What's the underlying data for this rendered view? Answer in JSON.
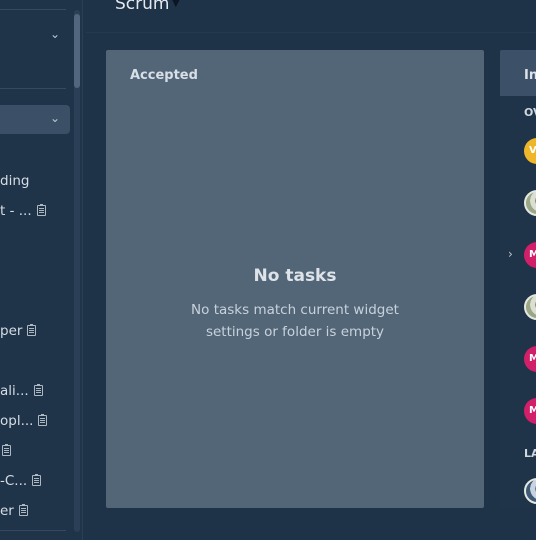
{
  "dashboard": {
    "title": "Scrum"
  },
  "sidebar": {
    "items": [
      {
        "label": "ding",
        "doc": false
      },
      {
        "label": "t - ...",
        "doc": true
      },
      {
        "label": "per",
        "doc": true
      },
      {
        "label": "ali...",
        "doc": true
      },
      {
        "label": "opl...",
        "doc": true
      },
      {
        "label": "",
        "doc": true
      },
      {
        "label": "-C...",
        "doc": true
      },
      {
        "label": "er",
        "doc": true
      }
    ]
  },
  "widgets": [
    {
      "title": "Accepted",
      "empty_title": "No tasks",
      "empty_message": "No tasks match current widget settings or folder is empty"
    },
    {
      "title": "In",
      "groups": [
        {
          "label": "OV"
        },
        {
          "label": "LA"
        }
      ],
      "avatars": [
        {
          "initial": "V",
          "color": "#f0b62a"
        },
        {
          "initial": "",
          "color": "photo"
        },
        {
          "initial": "M",
          "color": "#d21f6a"
        },
        {
          "initial": "",
          "color": "photo"
        },
        {
          "initial": "M",
          "color": "#d21f6a"
        },
        {
          "initial": "M",
          "color": "#d21f6a"
        },
        {
          "initial": "",
          "color": "photo"
        }
      ]
    }
  ],
  "colors": {
    "background": "#1e3248",
    "widget": "#526678",
    "sidebar": "#1f3349"
  }
}
